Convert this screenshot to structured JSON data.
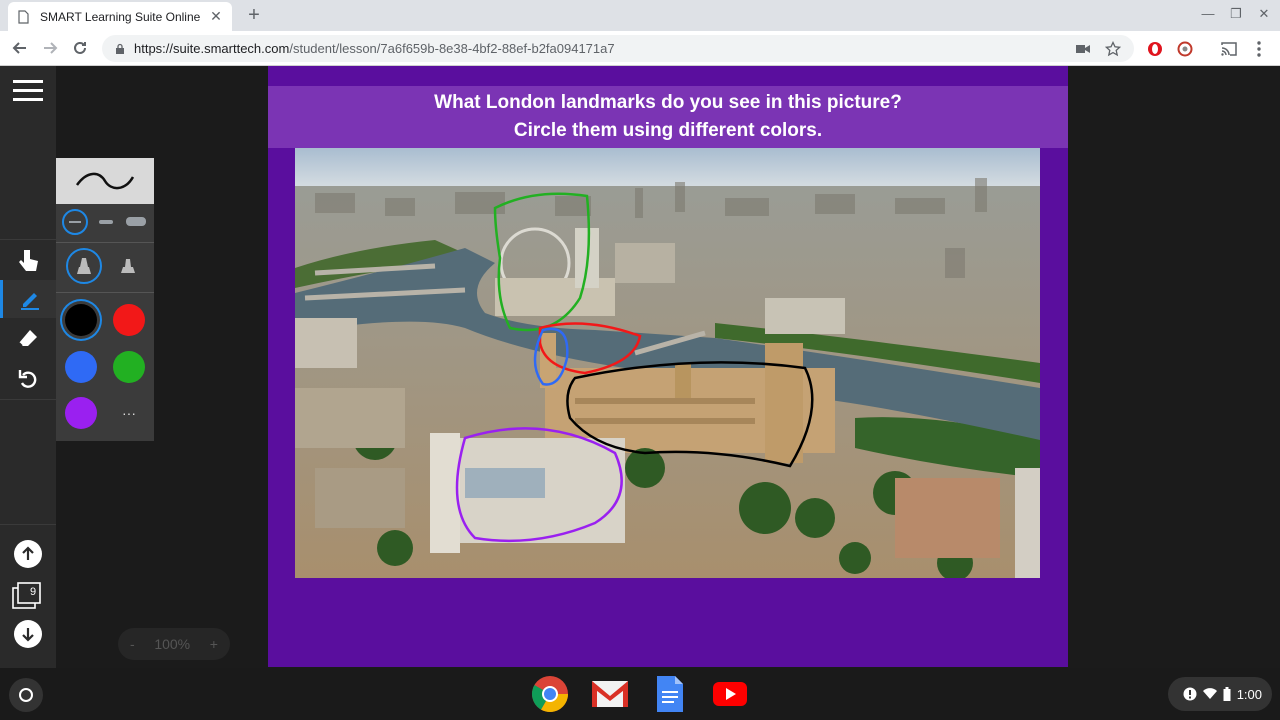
{
  "browser": {
    "tab_title": "SMART Learning Suite Online",
    "url_host": "https://suite.smarttech.com",
    "url_path": "/student/lesson/7a6f659b-8e38-4bf2-88ef-b2fa094171a7"
  },
  "tools": {
    "palette_colors": [
      "#000000",
      "#f21818",
      "#2f6af5",
      "#22b022",
      "#9a20f0"
    ],
    "selected_color": "#000000",
    "more_label": "···"
  },
  "pages": {
    "count": "9"
  },
  "zoom": {
    "minus": "-",
    "value": "100%",
    "plus": "+"
  },
  "slide": {
    "question_line1": "What London landmarks do you see in this picture?",
    "question_line2": "Circle them using different colors.",
    "annotation_colors": [
      "#22b022",
      "#f21818",
      "#2f6af5",
      "#000000",
      "#9a20f0"
    ]
  },
  "shelf": {
    "apps": [
      "chrome-icon",
      "gmail-icon",
      "docs-icon",
      "youtube-icon"
    ],
    "time": "1:00"
  }
}
